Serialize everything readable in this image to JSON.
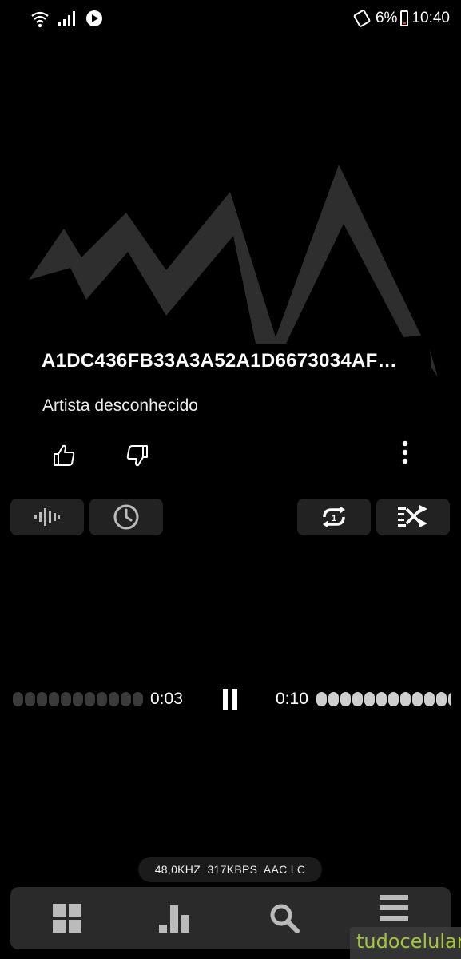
{
  "status_bar": {
    "battery": "6%",
    "time": "10:40",
    "icons": [
      "wifi-icon",
      "signal-icon",
      "play-notification-icon",
      "auto-rotate-icon",
      "battery-icon"
    ]
  },
  "track": {
    "title": "A1DC436FB33A3A52A1D6673034AF…",
    "artist": "Artista desconhecido"
  },
  "actions": [
    "thumbs-up-icon",
    "thumbs-down-icon",
    "more-options-icon"
  ],
  "controls": [
    "equalizer-icon",
    "sleep-timer-icon",
    "repeat-one-icon",
    "shuffle-icon"
  ],
  "playback": {
    "elapsed": "0:03",
    "remaining": "0:10",
    "state": "playing",
    "progress": 0.3
  },
  "format": {
    "sample_rate": "48,0KHZ",
    "bitrate": "317KBPS",
    "codec": "AAC LC"
  },
  "bottom_nav": [
    "grid-icon",
    "bar-chart-icon",
    "search-icon",
    "menu-icon"
  ],
  "watermark": {
    "text": "tudocelular",
    "color": "#a4c639"
  },
  "colors": {
    "background": "#000000",
    "button_bg": "#222222",
    "logo": "#2e2e2e"
  }
}
